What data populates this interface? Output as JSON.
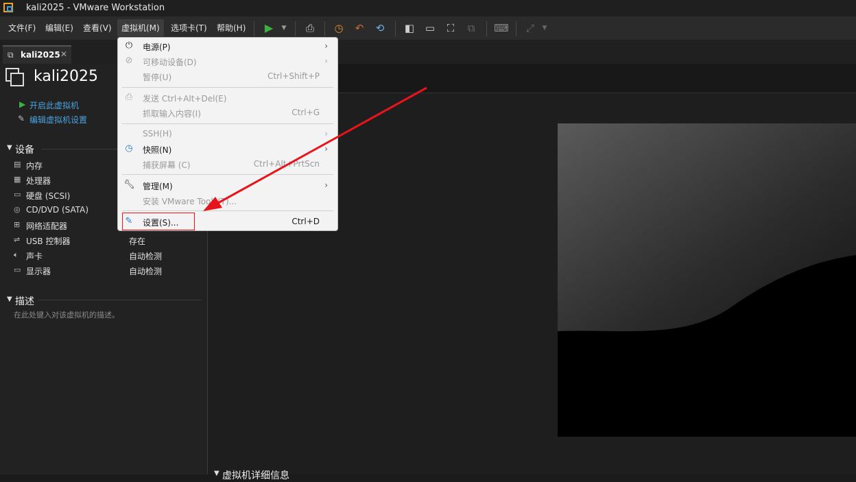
{
  "window": {
    "title": "kali2025 - VMware Workstation"
  },
  "menubar": {
    "items": [
      "文件(F)",
      "编辑(E)",
      "查看(V)",
      "虚拟机(M)",
      "选项卡(T)",
      "帮助(H)"
    ]
  },
  "tab": {
    "label": "kali2025",
    "close": "✕"
  },
  "vm": {
    "title": "kali2025",
    "actions": {
      "power_on": "开启此虚拟机",
      "edit_settings": "编辑虚拟机设置"
    }
  },
  "devices": {
    "section": "设备",
    "items": [
      {
        "name": "内存",
        "value": ""
      },
      {
        "name": "处理器",
        "value": ""
      },
      {
        "name": "硬盘 (SCSI)",
        "value": ""
      },
      {
        "name": "CD/DVD (SATA)",
        "value": ""
      },
      {
        "name": "网络适配器",
        "value": ""
      },
      {
        "name": "USB 控制器",
        "value": "存在"
      },
      {
        "name": "声卡",
        "value": "自动检测"
      },
      {
        "name": "显示器",
        "value": "自动检测"
      }
    ]
  },
  "description": {
    "section": "描述",
    "placeholder": "在此处键入对该虚拟机的描述。"
  },
  "details_section": "虚拟机详细信息",
  "vm_menu": {
    "power": "电源(P)",
    "removable": "可移动设备(D)",
    "pause": "暂停(U)",
    "pause_shortcut": "Ctrl+Shift+P",
    "send_cad": "发送 Ctrl+Alt+Del(E)",
    "grab_input": "抓取输入内容(I)",
    "grab_shortcut": "Ctrl+G",
    "ssh": "SSH(H)",
    "snapshot": "快照(N)",
    "capture": "捕获屏幕 (C)",
    "capture_shortcut": "Ctrl+Alt+PrtScn",
    "manage": "管理(M)",
    "install_tools": "安装 VMware Tools(T)...",
    "settings": "设置(S)...",
    "settings_shortcut": "Ctrl+D"
  },
  "colors": {
    "accent_green": "#3cb043",
    "link_blue": "#4aa3df",
    "annotation_red": "#e8141c"
  }
}
